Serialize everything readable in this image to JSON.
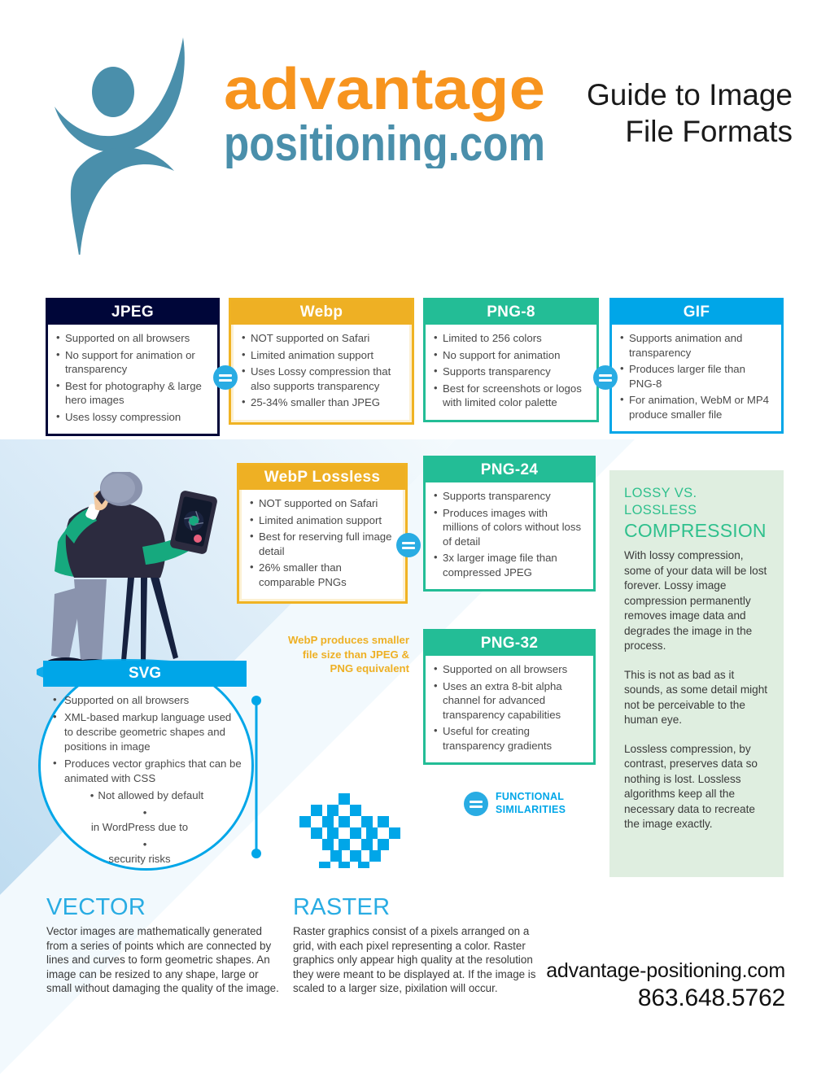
{
  "header": {
    "logo_word_top": "advantage",
    "logo_word_bottom": "positioning.com",
    "title_line1": "Guide to Image",
    "title_line2": "File Formats"
  },
  "cards": {
    "jpeg": {
      "title": "JPEG",
      "color": "#000639",
      "items": [
        "Supported on all browsers",
        "No support for animation or transparency",
        "Best for photography & large hero images",
        "Uses lossy compression"
      ]
    },
    "webp": {
      "title": "Webp",
      "color": "#eeb024",
      "items": [
        "NOT supported on Safari",
        "Limited animation support",
        "Uses Lossy compression that also supports transparency",
        "25-34% smaller than JPEG"
      ]
    },
    "png8": {
      "title": "PNG-8",
      "color": "#23bd96",
      "items": [
        "Limited to 256 colors",
        "No support for animation",
        "Supports transparency",
        "Best for screenshots or logos with limited color palette"
      ]
    },
    "gif": {
      "title": "GIF",
      "color": "#00a6e8",
      "items": [
        "Supports animation and transparency",
        "Produces larger file than PNG-8",
        "For animation, WebM or MP4 produce smaller file"
      ]
    },
    "webp_lossless": {
      "title": "WebP Lossless",
      "color": "#eeb024",
      "items": [
        "NOT supported on Safari",
        "Limited animation support",
        "Best for reserving full image detail",
        "26% smaller than comparable PNGs"
      ]
    },
    "png24": {
      "title": "PNG-24",
      "color": "#23bd96",
      "items": [
        "Supports transparency",
        "Produces images with millions of colors without loss of detail",
        "3x larger image file than compressed JPEG"
      ]
    },
    "png32": {
      "title": "PNG-32",
      "color": "#23bd96",
      "items": [
        "Supported on all browsers",
        "Uses an extra 8-bit alpha channel for advanced transparency capabilities",
        "Useful for creating transparency gradients"
      ]
    },
    "svg": {
      "title": "SVG",
      "color": "#00a6e8",
      "items": [
        "Supported on all browsers",
        "XML-based markup language used to describe geometric shapes and positions in image",
        "Produces vector graphics that can be animated with CSS"
      ],
      "final_item_line1": "Not allowed by default",
      "final_item_line2": "in WordPress due to",
      "final_item_line3": "security risks"
    }
  },
  "notes": {
    "webp_note_line1": "WebP produces smaller",
    "webp_note_line2": "file size than JPEG &",
    "webp_note_line3": "PNG equivalent",
    "functional_line1": "FUNCTIONAL",
    "functional_line2": "SIMILARITIES",
    "equals_symbol": "="
  },
  "compression": {
    "kicker": "LOSSY VS. LOSSLESS",
    "heading": "COMPRESSION",
    "accent_color": "#2fc08d",
    "background_color": "#dfeee0",
    "paragraph1": "With lossy compression, some of your data will be lost forever. Lossy image compression permanently removes image data and degrades the image in the process.",
    "paragraph2": "This is not as bad as it sounds, as some detail might not be perceivable to the human eye.",
    "paragraph3": "Lossless compression, by contrast, preserves data so nothing is lost. Lossless algorithms keep all the necessary data to recreate the image exactly."
  },
  "bottom": {
    "vector_heading": "VECTOR",
    "vector_text": "Vector images are mathematically generated from a series of points which are connected by lines and curves to form geometric shapes. An image can be resized to any shape, large or small without damaging the quality of the image.",
    "raster_heading": "RASTER",
    "raster_text": "Raster graphics consist of a pixels arranged on a grid, with each pixel representing a color. Raster graphics only appear high quality at the resolution they were meant to be displayed at. If the image is scaled to a larger size, pixilation will occur.",
    "heading_color": "#29ace3"
  },
  "contact": {
    "website": "advantage-positioning.com",
    "phone": "863.648.5762"
  }
}
